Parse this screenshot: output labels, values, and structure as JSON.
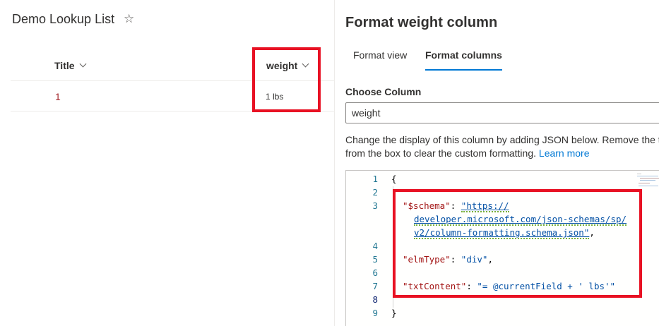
{
  "list": {
    "title": "Demo Lookup List",
    "star_icon": "star-outline-icon",
    "columns": [
      {
        "label": "Title",
        "chevron_icon": "chevron-down-icon"
      },
      {
        "label": "weight",
        "chevron_icon": "chevron-down-icon"
      }
    ],
    "rows": [
      {
        "title": "1",
        "weight": "1 lbs"
      }
    ]
  },
  "panel": {
    "title": "Format weight column",
    "tabs": [
      {
        "label": "Format view",
        "active": false
      },
      {
        "label": "Format columns",
        "active": true
      }
    ],
    "choose_column_label": "Choose Column",
    "choose_column_value": "weight",
    "description_line1": "Change the display of this column by adding JSON below. Remove the t",
    "description_line2": "from the box to clear the custom formatting.",
    "learn_more": "Learn more"
  },
  "editor": {
    "line_numbers": [
      "1",
      "2",
      "3",
      "4",
      "5",
      "6",
      "7",
      "8",
      "9"
    ],
    "lines": {
      "open_brace": "{",
      "schema_key": "\"$schema\"",
      "schema_colon": ": ",
      "schema_url_1": "\"https://",
      "schema_url_2": "developer.microsoft.com/json-schemas/sp/",
      "schema_url_3": "v2/column-formatting.schema.json\"",
      "schema_comma": ",",
      "elm_key": "\"elmType\"",
      "elm_colon": ": ",
      "elm_val": "\"div\"",
      "elm_comma": ",",
      "txt_key": "\"txtContent\"",
      "txt_colon": ": ",
      "txt_val": "\"= @currentField + ' lbs'\"",
      "close_brace": "}"
    }
  },
  "colors": {
    "highlight": "#e81123",
    "accent": "#0078d4",
    "json_key": "#a31515",
    "json_string": "#0451a5",
    "line_number": "#237893"
  }
}
